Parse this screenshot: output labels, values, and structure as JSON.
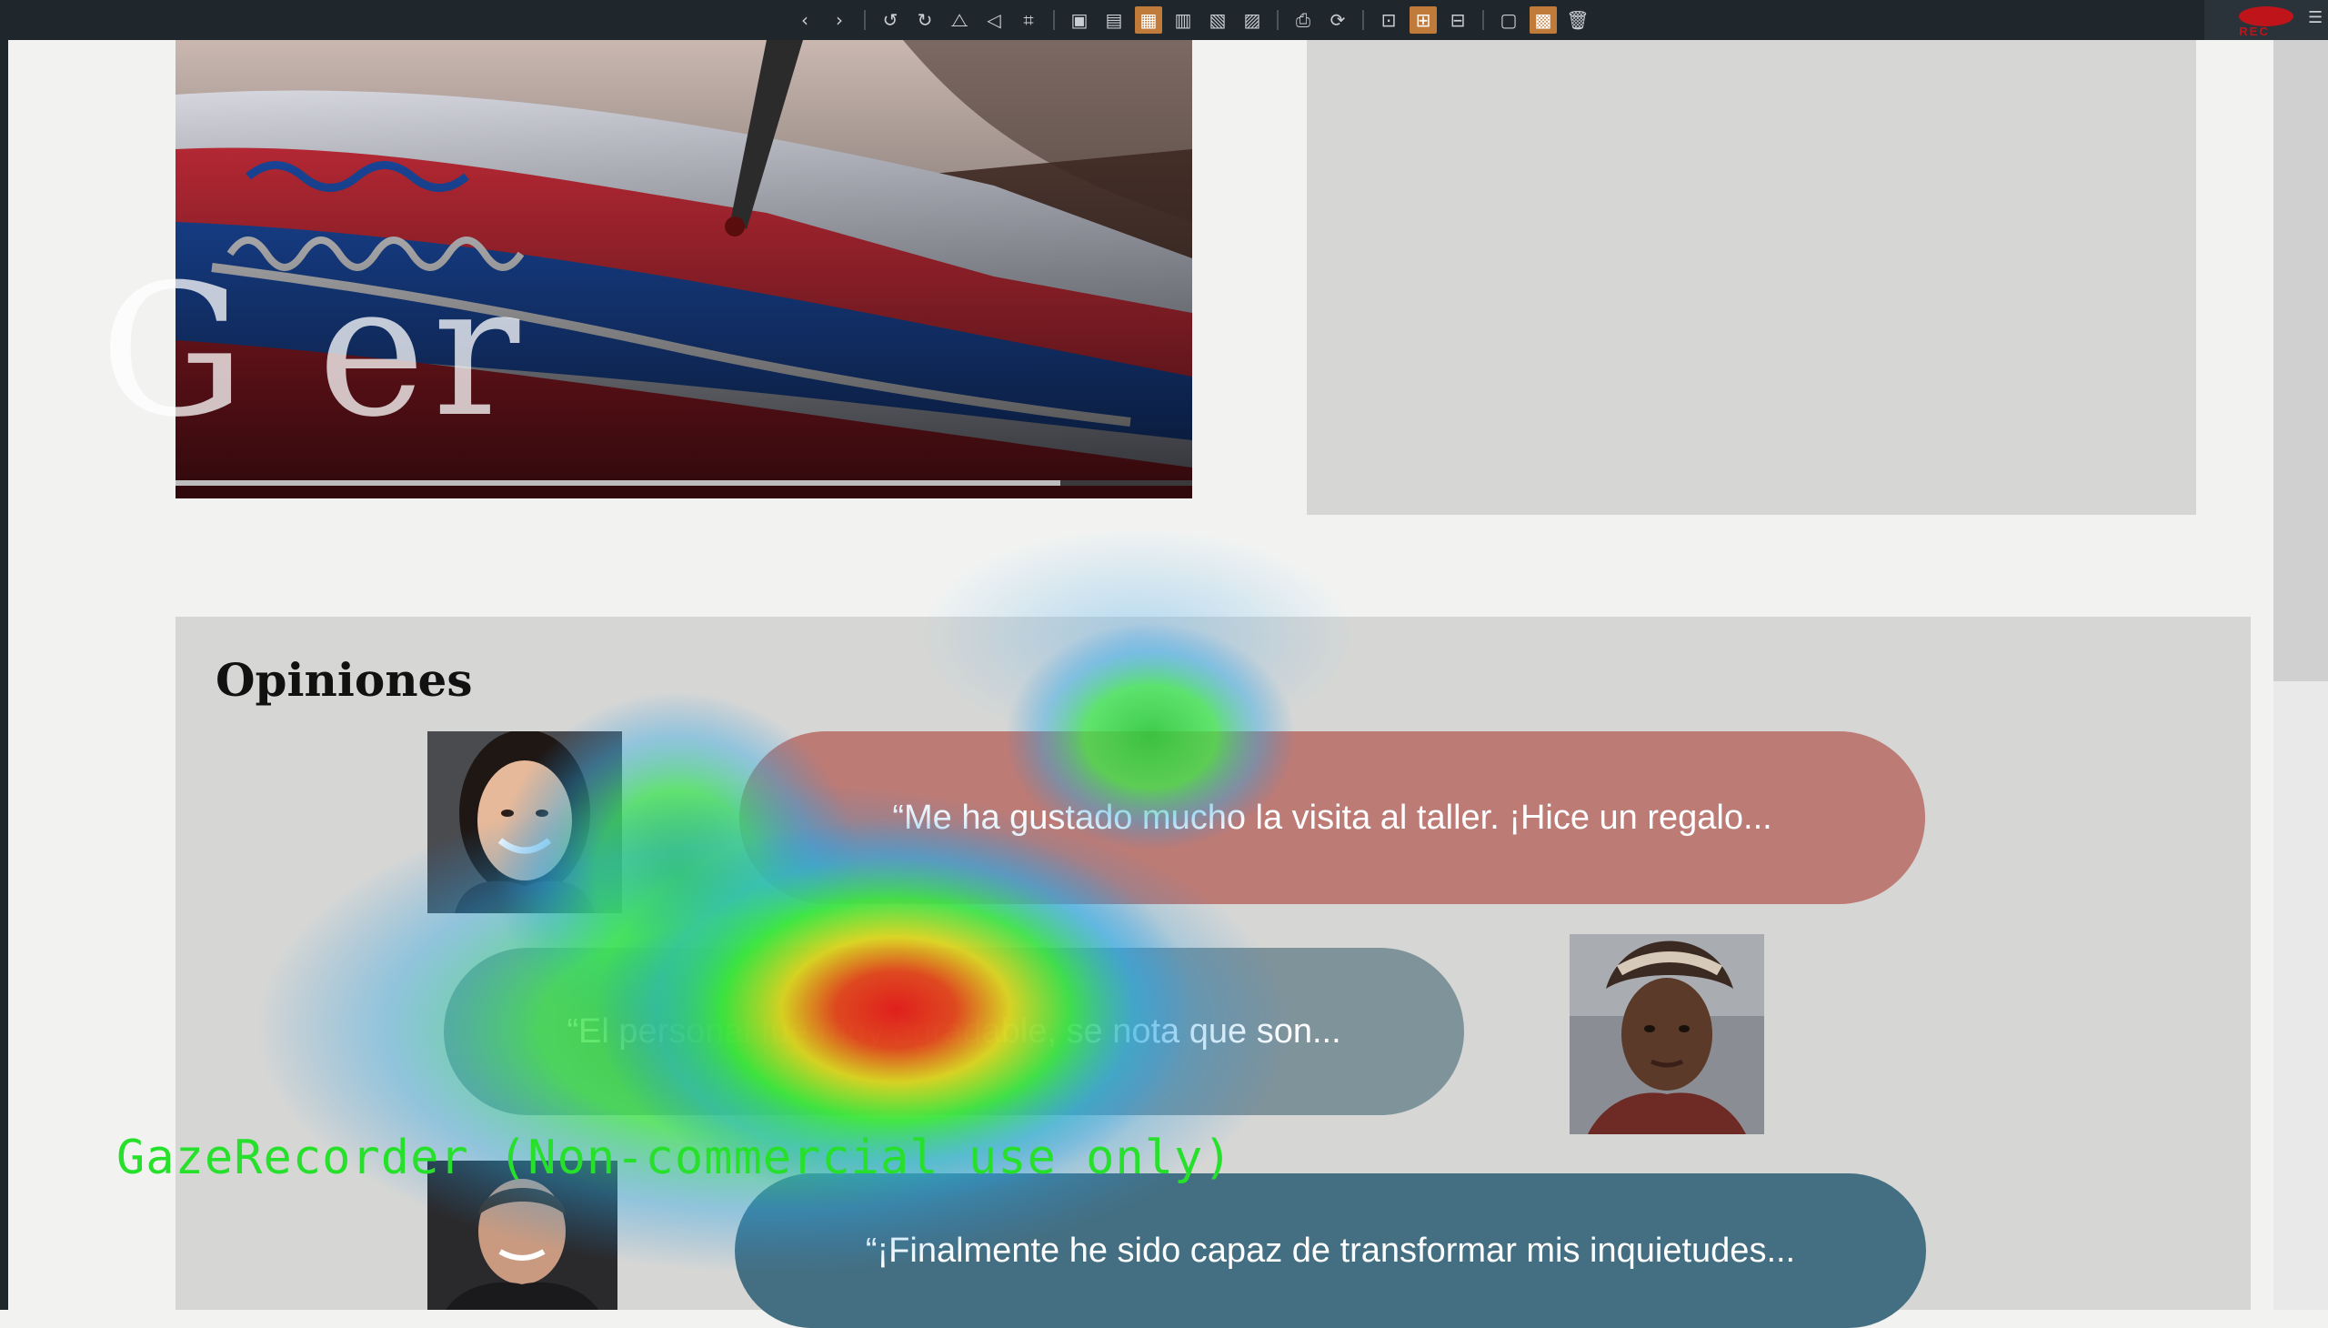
{
  "toolbar": {
    "items": [
      {
        "icon": "back-icon",
        "glyph": "‹"
      },
      {
        "icon": "forward-icon",
        "glyph": "›"
      },
      {
        "icon": "rotate-left-icon",
        "glyph": "↺"
      },
      {
        "icon": "rotate-right-icon",
        "glyph": "↻"
      },
      {
        "icon": "flip-horizontal-icon",
        "glyph": "⧍"
      },
      {
        "icon": "flip-vertical-icon",
        "glyph": "◁"
      },
      {
        "icon": "crop-icon",
        "glyph": "⌗"
      },
      {
        "icon": "frame-icon",
        "glyph": "▣"
      },
      {
        "icon": "lock-frame-icon",
        "glyph": "▤"
      },
      {
        "icon": "heatmap-view-icon",
        "glyph": "▦",
        "active": true
      },
      {
        "icon": "image-view-icon",
        "glyph": "▥"
      },
      {
        "icon": "grid-view-icon",
        "glyph": "▧"
      },
      {
        "icon": "layout-icon",
        "glyph": "▨"
      },
      {
        "icon": "print-icon",
        "glyph": "⎙"
      },
      {
        "icon": "refresh-icon",
        "glyph": "⟳"
      },
      {
        "icon": "resize-icon",
        "glyph": "⊡"
      },
      {
        "icon": "expand-icon",
        "glyph": "⊞",
        "active": true
      },
      {
        "icon": "screen-icon",
        "glyph": "⊟"
      },
      {
        "icon": "picture-icon",
        "glyph": "▢"
      },
      {
        "icon": "tiles-icon",
        "glyph": "▩",
        "active": true
      },
      {
        "icon": "trash-icon",
        "glyph": "🗑"
      }
    ],
    "rec_label": "REC",
    "accent": "#c07a3a"
  },
  "watermark_text": "G        er",
  "video": {
    "progress": 0.87
  },
  "opinions": {
    "title": "Opiniones",
    "items": [
      {
        "quote": "“Me ha gustado mucho la visita al taller. ¡Hice un regalo...",
        "color": "#bd7b75"
      },
      {
        "quote": "“El personal fue muy agradable, se nota que son...",
        "color": "#7f939b"
      },
      {
        "quote": "“¡Finalmente he sido capaz de transformar mis inquietudes...",
        "color": "#446f82"
      }
    ]
  },
  "gaze_watermark": "GazeRecorder (Non-commercial use only)"
}
